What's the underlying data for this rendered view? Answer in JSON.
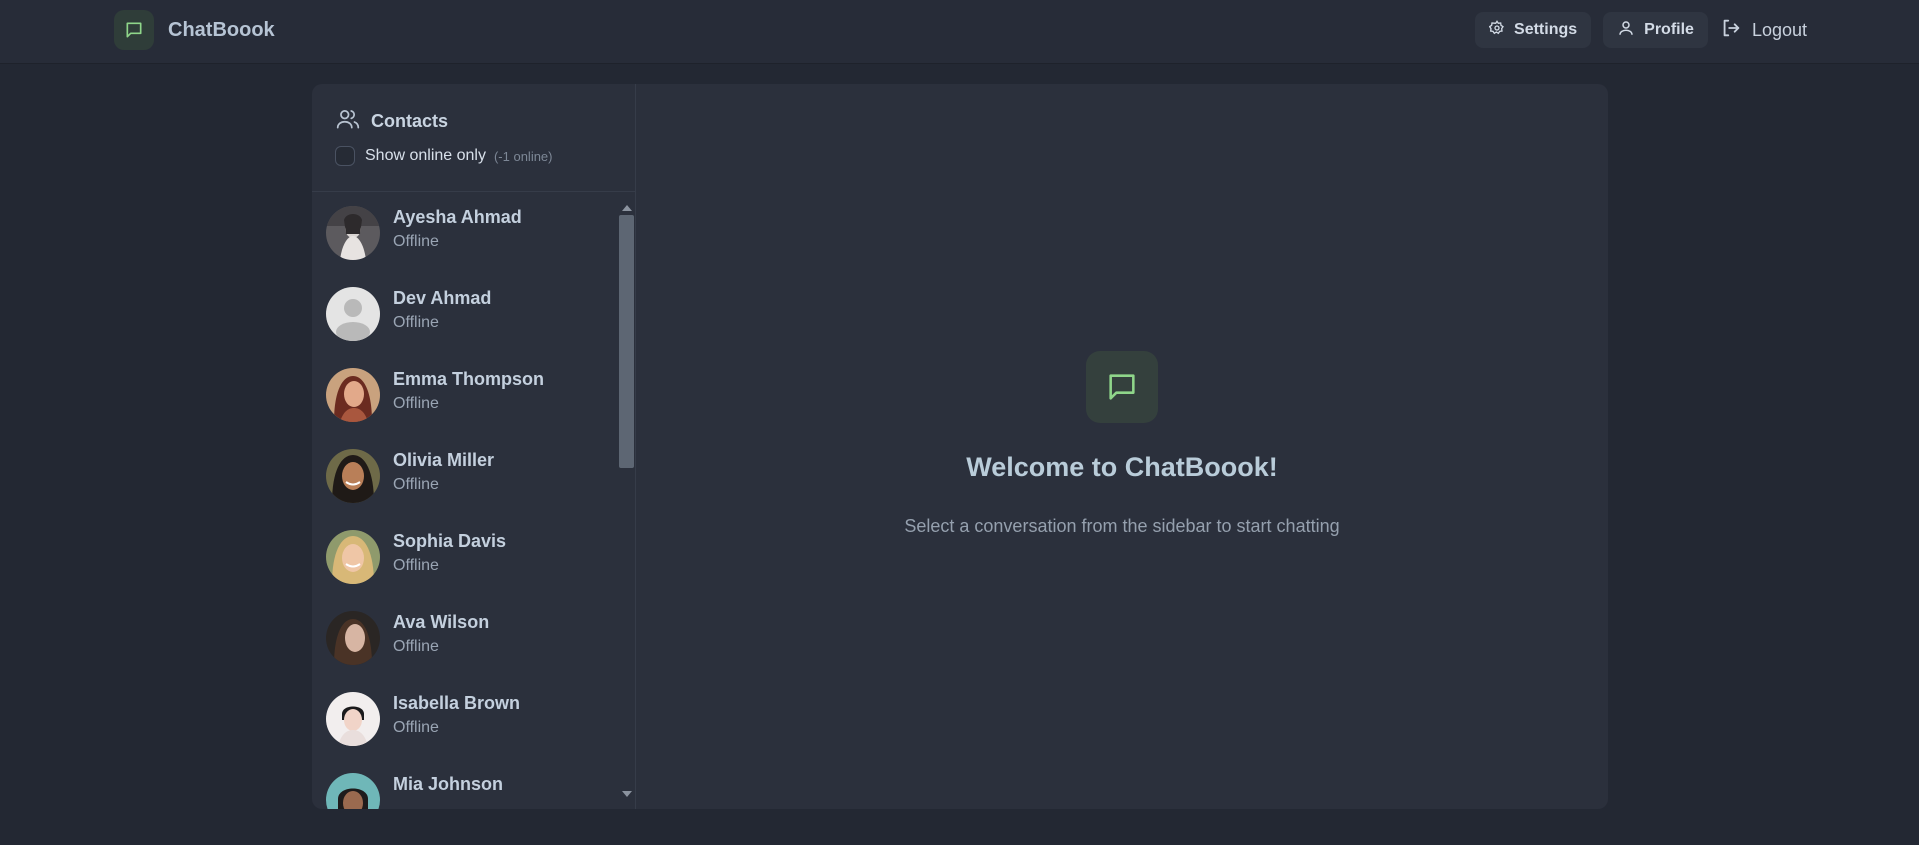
{
  "app": {
    "name": "ChatBoook"
  },
  "nav": {
    "settings_label": "Settings",
    "profile_label": "Profile",
    "logout_label": "Logout"
  },
  "sidebar": {
    "title": "Contacts",
    "online_toggle_label": "Show online only",
    "online_count": "(-1 online)",
    "online_only_checked": false,
    "contacts": [
      {
        "name": "Ayesha Ahmad",
        "status": "Offline"
      },
      {
        "name": "Dev Ahmad",
        "status": "Offline"
      },
      {
        "name": "Emma Thompson",
        "status": "Offline"
      },
      {
        "name": "Olivia Miller",
        "status": "Offline"
      },
      {
        "name": "Sophia Davis",
        "status": "Offline"
      },
      {
        "name": "Ava Wilson",
        "status": "Offline"
      },
      {
        "name": "Isabella Brown",
        "status": "Offline"
      },
      {
        "name": "Mia Johnson",
        "status": ""
      }
    ]
  },
  "main": {
    "welcome_title": "Welcome to ChatBoook!",
    "welcome_subtitle": "Select a conversation from the sidebar to start chatting"
  },
  "colors": {
    "background": "#232833",
    "panel": "#2b303c",
    "accent": "#8fd68a"
  }
}
